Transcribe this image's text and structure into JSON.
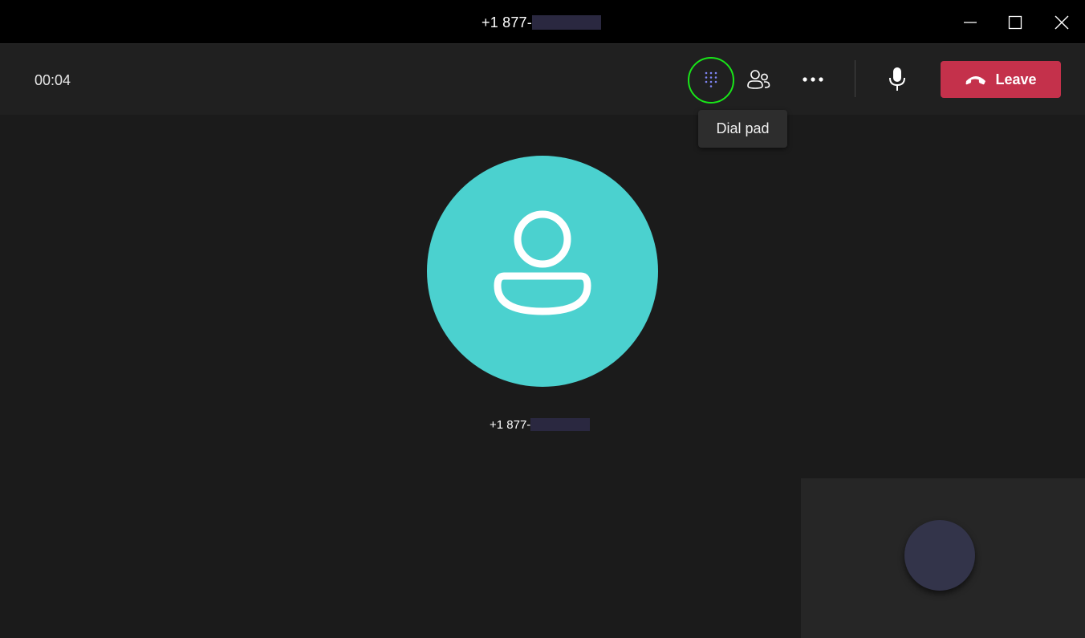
{
  "window": {
    "title": "+1 877-",
    "controls": {
      "minimize_icon": "minimize-icon",
      "maximize_icon": "maximize-icon",
      "close_icon": "close-icon"
    }
  },
  "toolbar": {
    "call_timer": "00:04",
    "dialpad_icon": "dialpad-icon",
    "people_icon": "people-icon",
    "more_icon": "more-options-icon",
    "mic_icon": "microphone-icon",
    "leave_label": "Leave",
    "leave_icon": "hang-up-icon"
  },
  "tooltip": {
    "text": "Dial pad"
  },
  "caller": {
    "name": "+1 877-",
    "avatar_icon": "person-icon"
  },
  "colors": {
    "leave_button": "#c4314b",
    "avatar_bg": "#4bd1cf",
    "highlight_ring": "#19e619",
    "dialpad_accent": "#7f85f5",
    "self_avatar": "#33344a"
  }
}
